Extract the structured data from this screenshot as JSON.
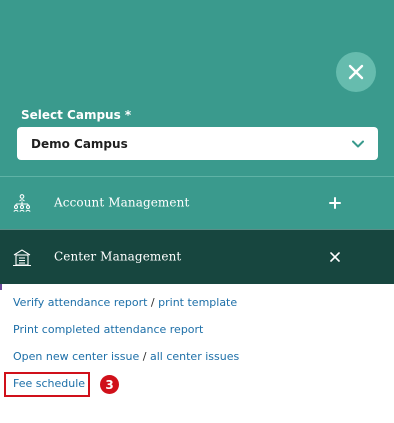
{
  "campus": {
    "label": "Select Campus *",
    "selected": "Demo Campus"
  },
  "menu": {
    "account": {
      "label": "Account Management",
      "toggle": "+"
    },
    "center": {
      "label": "Center Management",
      "toggle": "×"
    }
  },
  "links": {
    "verify_attendance": "Verify attendance report",
    "print_template": "print template",
    "print_completed": "Print completed attendance report",
    "open_issue": "Open new center issue",
    "all_issues": "all center issues",
    "fee_schedule": "Fee schedule",
    "separator": "/"
  },
  "annotation": {
    "step": "3"
  },
  "colors": {
    "teal": "#3a9a8d",
    "dark_teal": "#17463f",
    "close_circle": "#66bcae",
    "link_blue": "#1d6fa8",
    "highlight_red": "#d0101a"
  },
  "icons": {
    "close": "close-icon",
    "dropdown": "chevron-down-icon",
    "account": "org-chart-icon",
    "center": "building-icon",
    "expand": "plus-icon",
    "collapse": "close-icon"
  }
}
